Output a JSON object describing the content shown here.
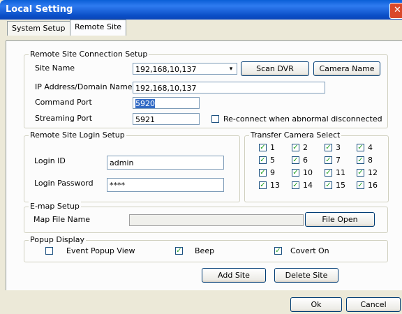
{
  "window": {
    "title": "Local Setting",
    "close_glyph": "✕"
  },
  "tabs": [
    {
      "label": "System Setup"
    },
    {
      "label": "Remote Site"
    }
  ],
  "connection": {
    "legend": "Remote Site Connection Setup",
    "site_name_label": "Site Name",
    "site_name_value": "192,168,10,137",
    "scan_dvr": "Scan DVR",
    "camera_name": "Camera Name",
    "ip_label": "IP Address/Domain Name",
    "ip_value": "192,168,10,137",
    "command_port_label": "Command Port",
    "command_port_value": "5920",
    "streaming_port_label": "Streaming Port",
    "streaming_port_value": "5921",
    "reconnect_label": "Re-connect when abnormal disconnected",
    "reconnect_checked": false
  },
  "login": {
    "legend": "Remote Site Login Setup",
    "id_label": "Login ID",
    "id_value": "admin",
    "password_label": "Login Password",
    "password_value": "****"
  },
  "transfer": {
    "legend": "Transfer Camera Select",
    "cameras": [
      "1",
      "2",
      "3",
      "4",
      "5",
      "6",
      "7",
      "8",
      "9",
      "10",
      "11",
      "12",
      "13",
      "14",
      "15",
      "16"
    ]
  },
  "emap": {
    "legend": "E-map Setup",
    "map_label": "Map File Name",
    "map_value": "",
    "file_open": "File Open"
  },
  "popup": {
    "legend": "Popup Display",
    "event_popup": "Event Popup View",
    "event_popup_checked": false,
    "beep": "Beep",
    "beep_checked": true,
    "covert": "Covert On",
    "covert_checked": true
  },
  "actions": {
    "add_site": "Add Site",
    "delete_site": "Delete Site"
  },
  "footer": {
    "ok": "Ok",
    "cancel": "Cancel"
  },
  "icons": {
    "dropdown": "▾",
    "check": "✓"
  }
}
